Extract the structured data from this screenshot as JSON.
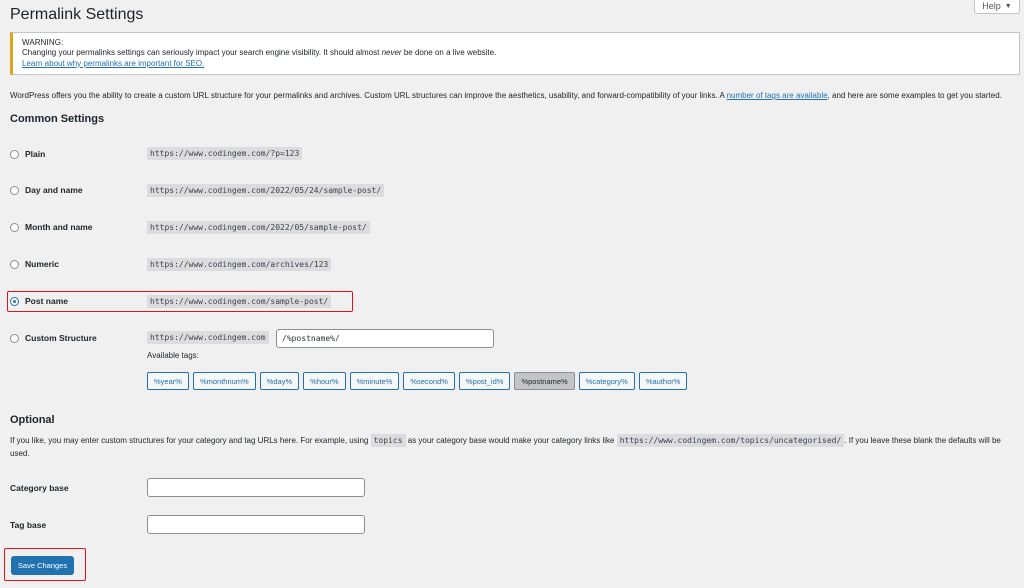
{
  "help": {
    "label": "Help",
    "caret": "▼"
  },
  "page_title": "Permalink Settings",
  "notice": {
    "title": "WARNING:",
    "text_before": "Changing your permalinks settings can seriously impact your search engine visibility. It should almost ",
    "text_em": "never",
    "text_after": " be done on a live website.",
    "link": "Learn about why permalinks are important for SEO."
  },
  "intro": {
    "before": "WordPress offers you the ability to create a custom URL structure for your permalinks and archives. Custom URL structures can improve the aesthetics, usability, and forward-compatibility of your links. A ",
    "link": "number of tags are available",
    "after": ", and here are some examples to get you started."
  },
  "common_heading": "Common Settings",
  "options": [
    {
      "label": "Plain",
      "example": "https://www.codingem.com/?p=123",
      "checked": false
    },
    {
      "label": "Day and name",
      "example": "https://www.codingem.com/2022/05/24/sample-post/",
      "checked": false
    },
    {
      "label": "Month and name",
      "example": "https://www.codingem.com/2022/05/sample-post/",
      "checked": false
    },
    {
      "label": "Numeric",
      "example": "https://www.codingem.com/archives/123",
      "checked": false
    },
    {
      "label": "Post name",
      "example": "https://www.codingem.com/sample-post/",
      "checked": true
    },
    {
      "label": "Custom Structure",
      "example": "https://www.codingem.com",
      "checked": false
    }
  ],
  "custom_structure_value": "/%postname%/",
  "available_tags_label": "Available tags:",
  "tags": [
    "%year%",
    "%monthnum%",
    "%day%",
    "%hour%",
    "%minute%",
    "%second%",
    "%post_id%",
    "%postname%",
    "%category%",
    "%author%"
  ],
  "active_tag": "%postname%",
  "optional": {
    "heading": "Optional",
    "text_1": "If you like, you may enter custom structures for your category and tag URLs here. For example, using ",
    "code_1": "topics",
    "text_2": " as your category base would make your category links like ",
    "code_2": "https://www.codingem.com/topics/uncategorised/",
    "text_3": ". If you leave these blank the defaults will be",
    "text_4": "used."
  },
  "category_base": {
    "label": "Category base",
    "value": ""
  },
  "tag_base": {
    "label": "Tag base",
    "value": ""
  },
  "save_label": "Save Changes",
  "colors": {
    "primary": "#2271b1",
    "warning": "#dba617",
    "highlight": "#e0141b"
  }
}
